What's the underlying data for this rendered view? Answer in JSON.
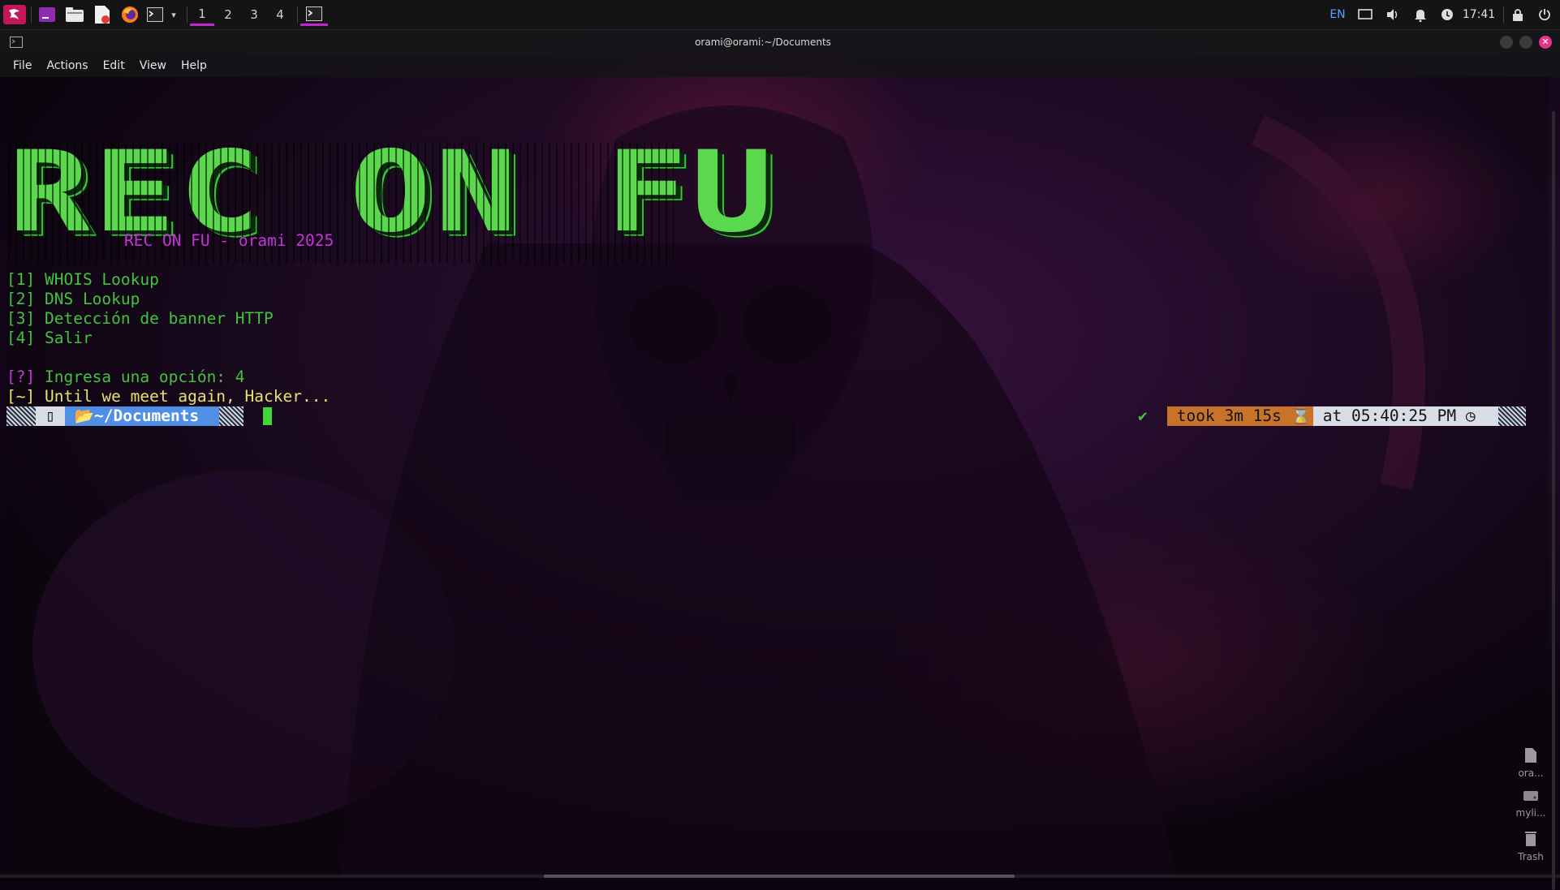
{
  "topbar": {
    "workspaces": [
      "1",
      "2",
      "3",
      "4"
    ],
    "active_workspace": "1",
    "tray": {
      "language": "EN",
      "clock": "17:41"
    }
  },
  "window": {
    "title": "orami@orami:~/Documents"
  },
  "menubar": {
    "items": [
      "File",
      "Actions",
      "Edit",
      "View",
      "Help"
    ]
  },
  "terminal": {
    "banner": "REC ON FU",
    "subtitle": "REC ON FU - orami 2025",
    "menu": [
      {
        "key": "[1]",
        "label": "WHOIS Lookup"
      },
      {
        "key": "[2]",
        "label": "DNS Lookup"
      },
      {
        "key": "[3]",
        "label": "Detección de banner HTTP"
      },
      {
        "key": "[4]",
        "label": "Salir"
      }
    ],
    "prompt_question_marker": "[?]",
    "prompt_question": "Ingresa una opción: 4",
    "farewell_marker": "[~]",
    "farewell": "Until we meet again, Hacker...",
    "prompt": {
      "directory": "~/Documents",
      "status_check": "✔",
      "took": "took 3m 15s",
      "at": "at 05:40:25 PM"
    }
  },
  "desktop_icons": [
    {
      "label": "ora...",
      "icon": "file-icon"
    },
    {
      "label": "myli...",
      "icon": "drive-icon"
    },
    {
      "label": "Trash",
      "icon": "trash-icon"
    }
  ],
  "colors": {
    "accent": "#c026d3",
    "terminal_green": "#41c43b",
    "terminal_magenta": "#c236d6",
    "terminal_yellow": "#e8e070",
    "prompt_blue": "#4f8fe6",
    "prompt_orange": "#c8732a"
  }
}
